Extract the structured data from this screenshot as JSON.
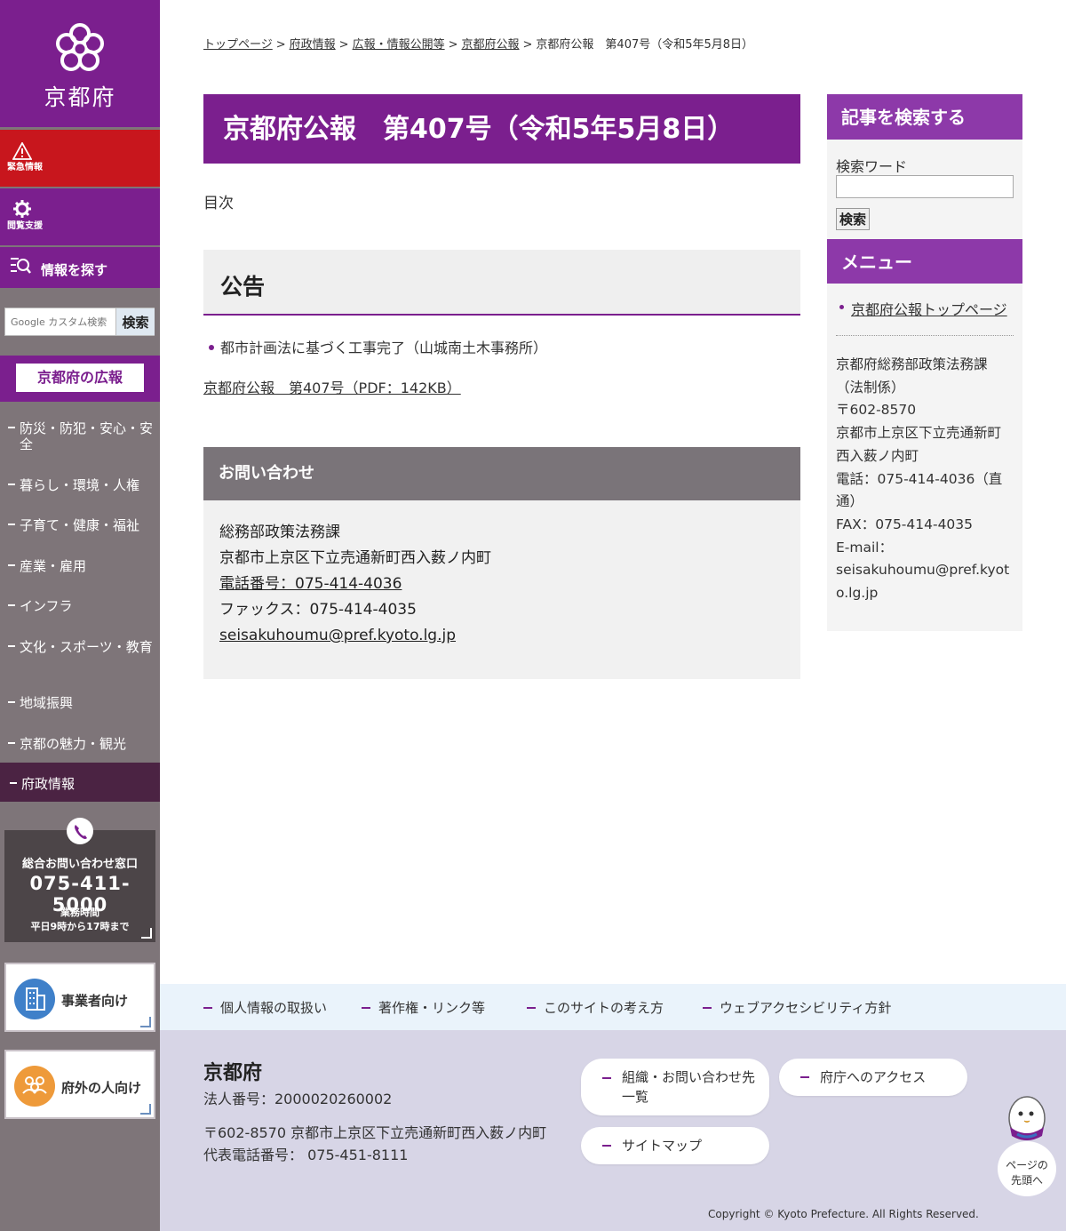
{
  "colors": {
    "brand_purple": "#7b1f8e",
    "emergency_red": "#c8161d",
    "sidebar_gray": "#7e7579"
  },
  "sidebar": {
    "logo_text": "京都府",
    "emergency_label": "緊急情報",
    "accessibility_label": "閲覧支援",
    "find_info_label": "情報を探す",
    "search": {
      "placeholder": "Google カスタム検索",
      "button": "検索"
    },
    "pr_label": "京都府の広報",
    "nav_items": [
      {
        "label": "防災・防犯・安心・安全"
      },
      {
        "label": "暮らし・環境・人権"
      },
      {
        "label": "子育て・健康・福祉"
      },
      {
        "label": "産業・雇用"
      },
      {
        "label": "インフラ"
      },
      {
        "label": "文化・スポーツ・教育"
      },
      {
        "label": "地域振興"
      },
      {
        "label": "京都の魅力・観光"
      },
      {
        "label": "府政情報"
      }
    ],
    "contact": {
      "title": "総合お問い合わせ窓口",
      "phone": "075-411-5000",
      "hours_label": "業務時間",
      "hours": "平日9時から17時まで"
    },
    "audience": [
      {
        "label": "事業者向け"
      },
      {
        "label": "府外の人向け"
      }
    ]
  },
  "breadcrumb": {
    "items": [
      "トップページ",
      "府政情報",
      "広報・情報公開等",
      "京都府公報"
    ],
    "current": "京都府公報　第407号（令和5年5月8日）",
    "separator": ">"
  },
  "main": {
    "title": "京都府公報　第407号（令和5年5月8日）",
    "toc": "目次",
    "section_heading": "公告",
    "notice_item": "都市計画法に基づく工事完了（山城南土木事務所）",
    "pdf_link": "京都府公報　第407号（PDF：142KB）",
    "inquiry": {
      "heading": "お問い合わせ",
      "department": "総務部政策法務課",
      "address": "京都市上京区下立売通新町西入薮ノ内町",
      "phone": "電話番号：075-414-4036",
      "fax": "ファックス：075-414-4035",
      "email": "seisakuhoumu@pref.kyoto.lg.jp"
    }
  },
  "right": {
    "search_heading": "記事を検索する",
    "keyword_label": "検索ワード",
    "search_button": "検索",
    "menu_heading": "メニュー",
    "menu_item": "京都府公報トップページ",
    "address_lines": [
      "京都府総務部政策法務課",
      "（法制係）",
      "〒602-8570",
      "京都市上京区下立売通新町",
      "西入薮ノ内町",
      "電話：075-414-4036（直通）",
      "FAX：075-414-4035",
      "E-mail：",
      "seisakuhoumu@pref.kyoto.lg.jp"
    ]
  },
  "footer": {
    "links": [
      "個人情報の取扱い",
      "著作権・リンク等",
      "このサイトの考え方",
      "ウェブアクセシビリティ方針"
    ],
    "name": "京都府",
    "corp_number": "法人番号：2000020260002",
    "address": "〒602-8570 京都市上京区下立売通新町西入薮ノ内町",
    "tel": "代表電話番号： 075-451-8111",
    "buttons": [
      "組織・お問い合わせ先一覧",
      "府庁へのアクセス",
      "サイトマップ"
    ],
    "copyright": "Copyright © Kyoto Prefecture. All Rights Reserved.",
    "pagetop_line1": "ページの",
    "pagetop_line2": "先頭へ"
  }
}
